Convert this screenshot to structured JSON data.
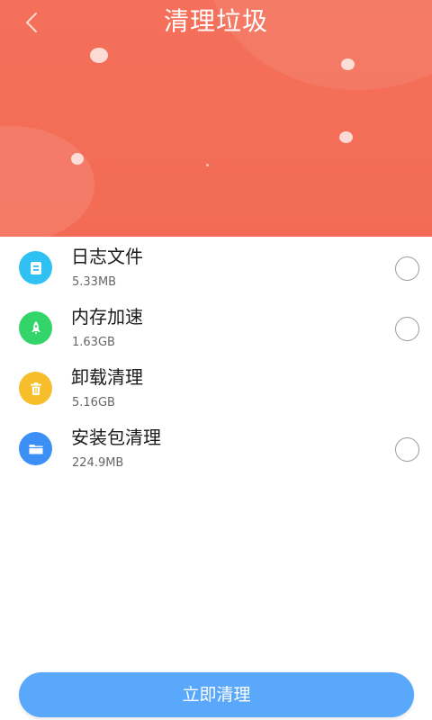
{
  "header": {
    "title": "清理垃圾",
    "back_icon": "chevron-left-icon",
    "background_color": "#f36b55"
  },
  "items": [
    {
      "name": "日志文件",
      "size": "5.33MB",
      "icon": "document-icon",
      "icon_color": "#2fc1f1",
      "has_radio": true
    },
    {
      "name": "内存加速",
      "size": "1.63GB",
      "icon": "rocket-icon",
      "icon_color": "#33d46a",
      "has_radio": true
    },
    {
      "name": "卸载清理",
      "size": "5.16GB",
      "icon": "trash-icon",
      "icon_color": "#f7be2b",
      "has_radio": false
    },
    {
      "name": "安装包清理",
      "size": "224.9MB",
      "icon": "folder-icon",
      "icon_color": "#3b8ff5",
      "has_radio": true
    }
  ],
  "action": {
    "label": "立即清理",
    "color": "#5aa8fb"
  }
}
